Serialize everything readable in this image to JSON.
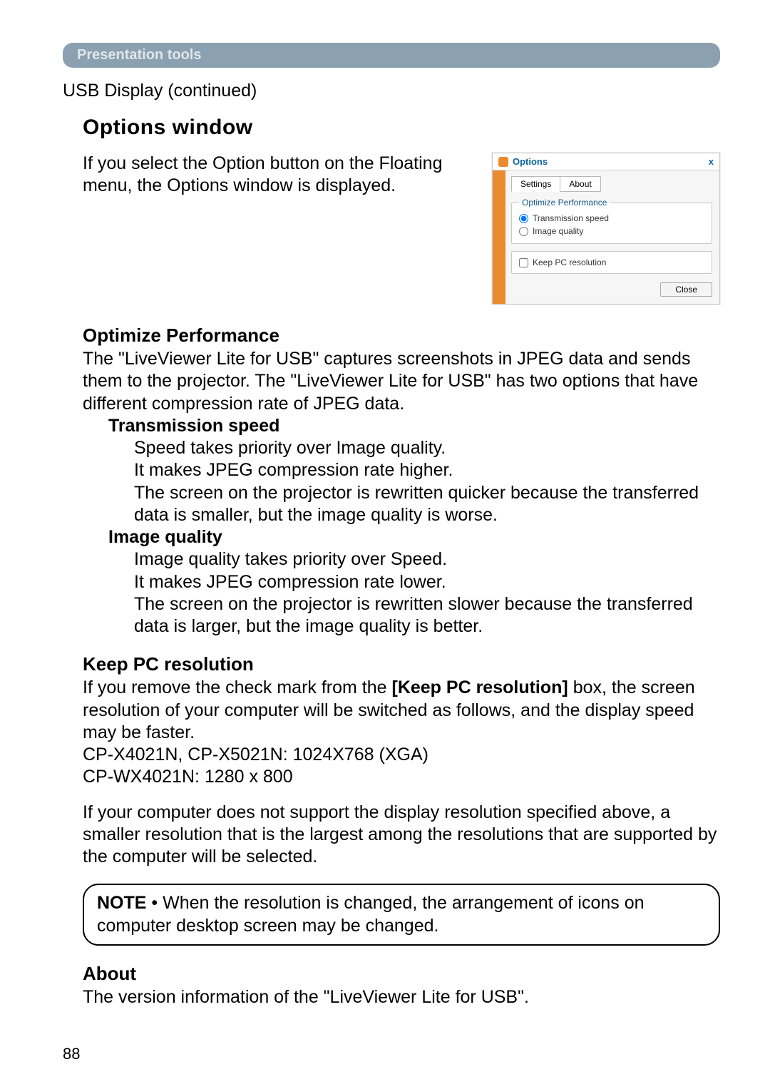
{
  "breadcrumb": "Presentation tools",
  "continued": "USB Display (continued)",
  "section_title": "Options window",
  "intro": "If you select the Option button on the Floating menu, the Options window is displayed.",
  "opt_perf": {
    "heading": "Optimize Performance",
    "para": "The \"LiveViewer Lite for USB\" captures screenshots in JPEG data and sends them to the projector. The \"LiveViewer Lite for USB\" has two options that have different compression rate of JPEG data.",
    "speed_title": "Transmission speed",
    "speed_lines": [
      "Speed takes priority over Image quality.",
      "It makes JPEG compression rate higher.",
      "The screen on the projector is rewritten quicker because the transferred data is smaller, but the image quality is worse."
    ],
    "quality_title": "Image quality",
    "quality_lines": [
      "Image quality takes priority over Speed.",
      "It makes JPEG compression rate lower.",
      "The screen on the projector is rewritten slower because the transferred data is larger, but the image quality is better."
    ]
  },
  "keep_pc": {
    "heading": "Keep PC resolution",
    "para1_a": "If you remove the check mark from the ",
    "para1_bold": "[Keep PC resolution]",
    "para1_b": " box, the screen resolution of your computer will be switched as follows, and the display speed may be faster.",
    "line1": "CP-X4021N, CP-X5021N: 1024X768 (XGA)",
    "line2": "CP-WX4021N: 1280 x 800",
    "para2": "If your computer does not support the display resolution specified above, a smaller resolution that is the largest among the resolutions that are supported by the computer will be selected."
  },
  "note": {
    "label": "NOTE",
    "text": "  • When the resolution is changed, the arrangement of icons on computer desktop screen may be changed."
  },
  "about": {
    "heading": "About",
    "text": "The version information of the \"LiveViewer Lite for USB\"."
  },
  "page_number": "88",
  "dialog": {
    "title": "Options",
    "close_x": "x",
    "tab_settings": "Settings",
    "tab_about": "About",
    "legend": "Optimize Performance",
    "radio_speed": "Transmission speed",
    "radio_quality": "Image quality",
    "checkbox": "Keep PC resolution",
    "close_btn": "Close"
  }
}
